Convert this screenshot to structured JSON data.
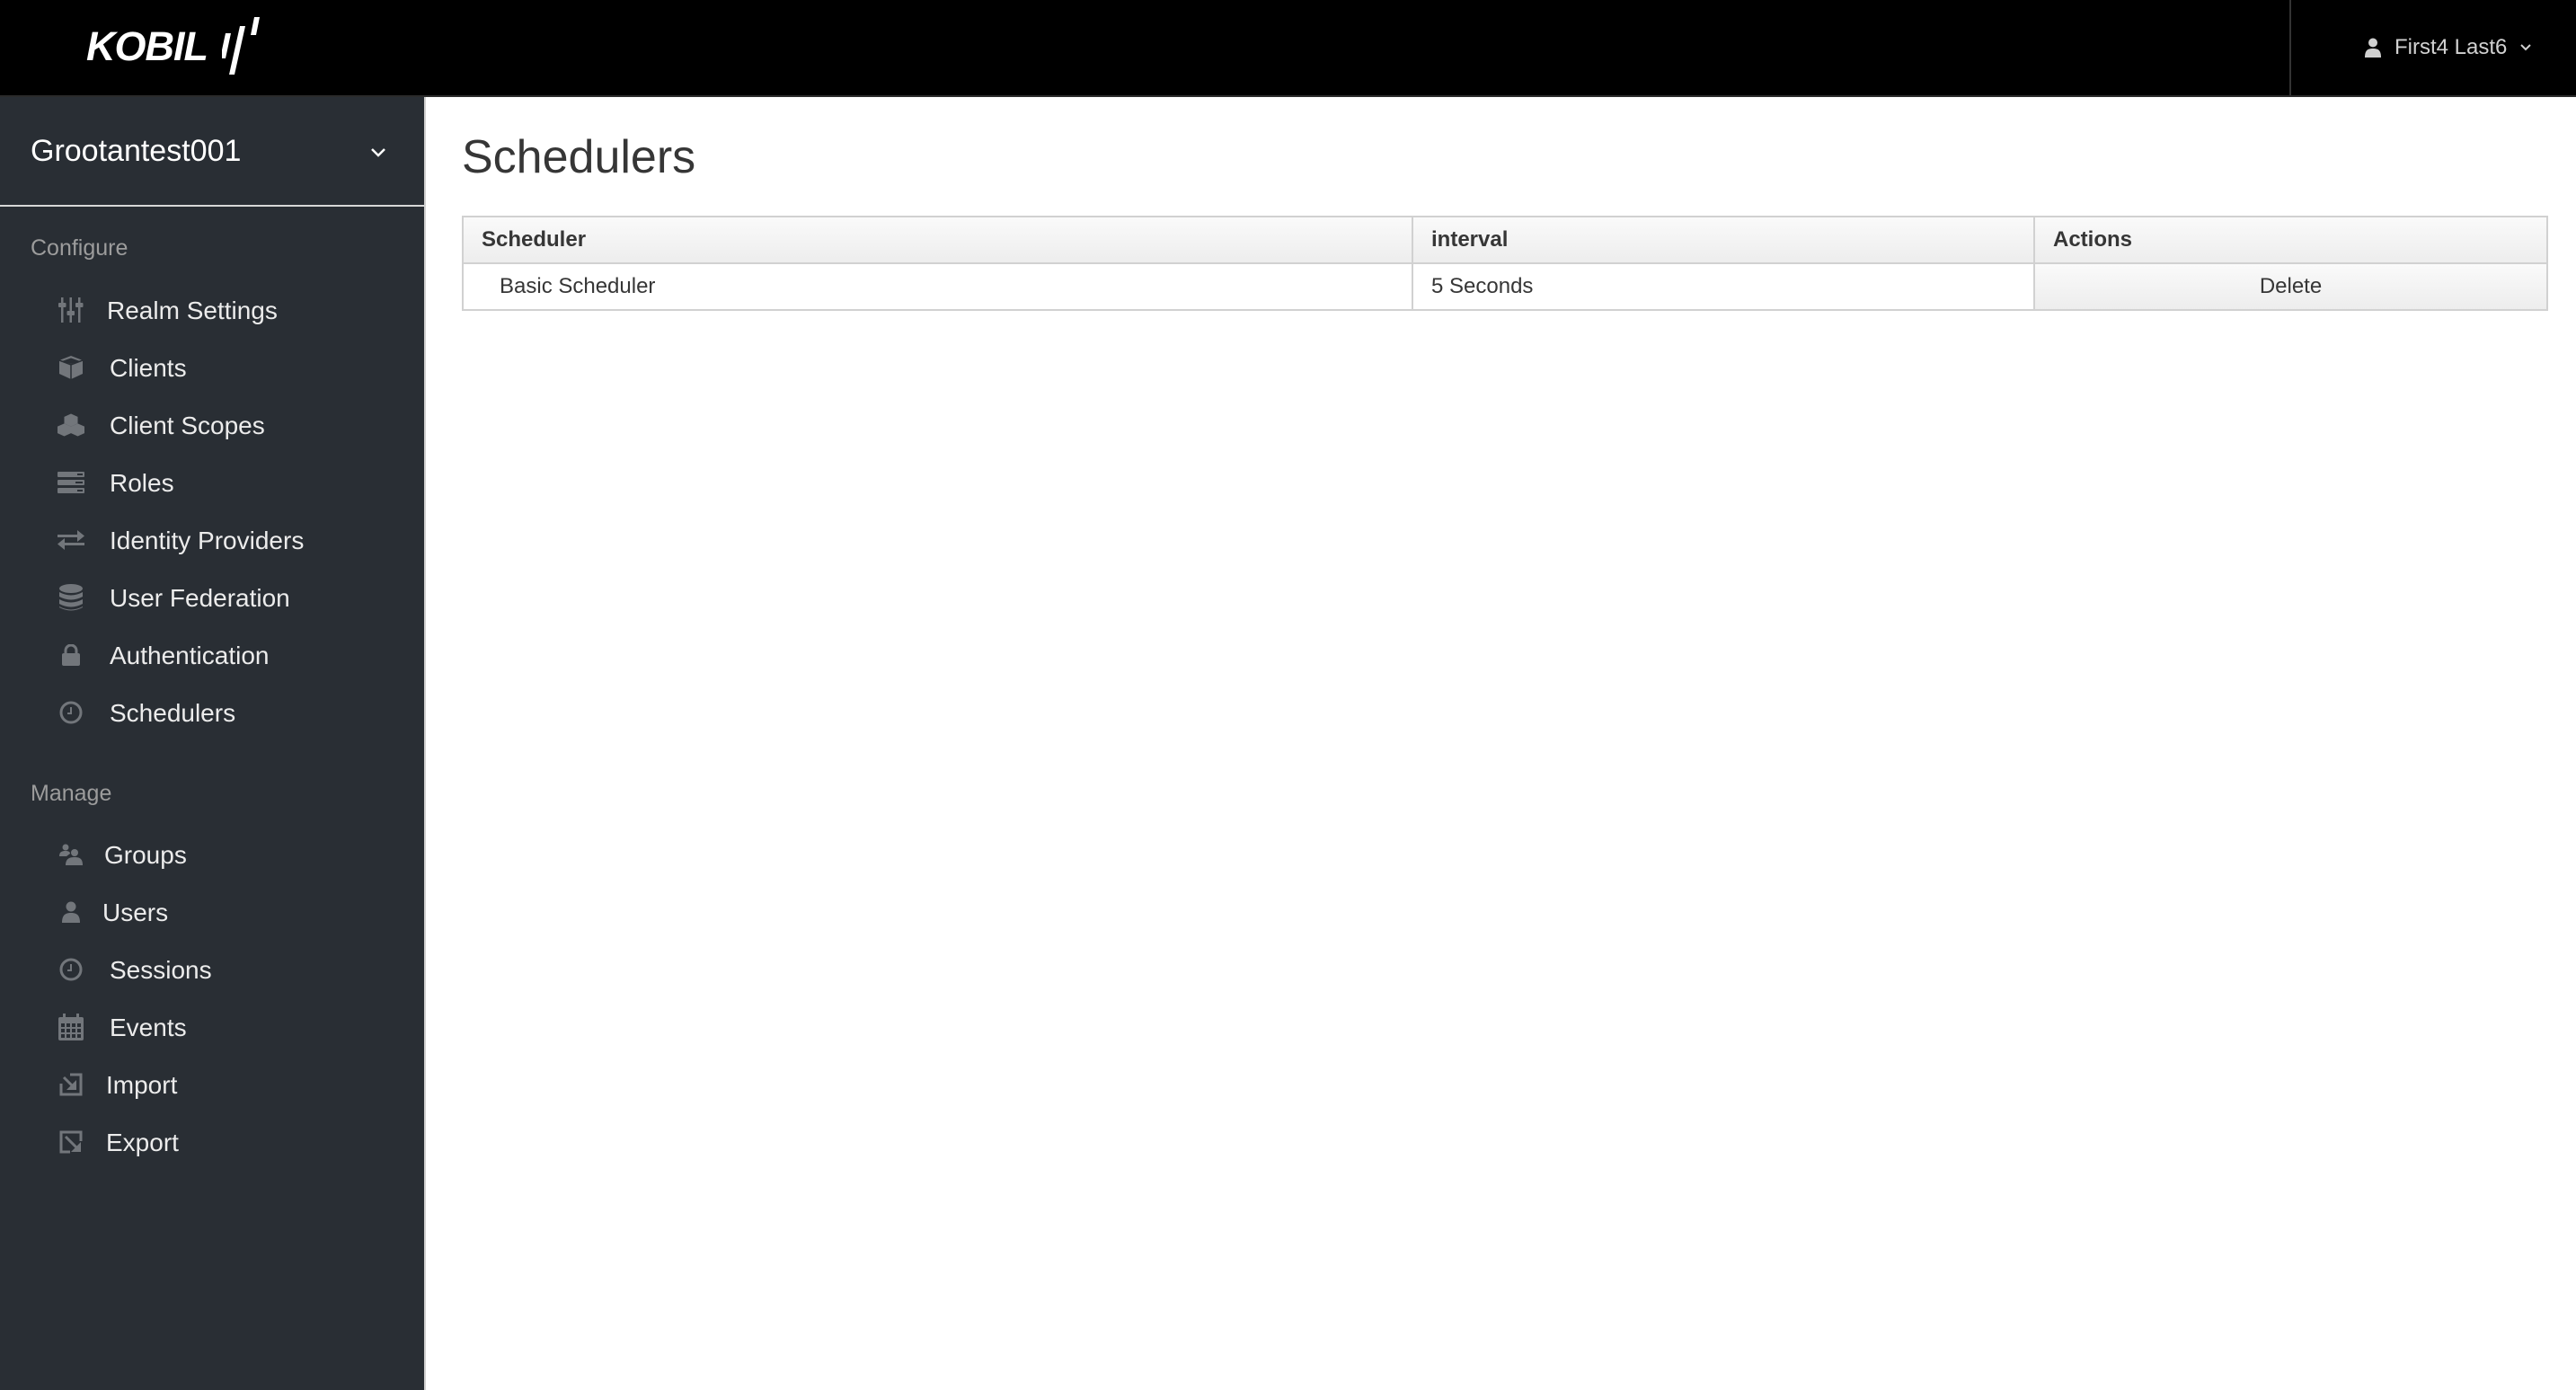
{
  "header": {
    "logo_text": "KOBIL",
    "user_name": "First4 Last6",
    "user_icon": "user-icon",
    "user_menu_icon": "chevron-down-icon"
  },
  "sidebar": {
    "realm": {
      "name": "Grootantest001",
      "icon": "chevron-down-icon"
    },
    "sections": [
      {
        "label": "Configure",
        "items": [
          {
            "label": "Realm Settings",
            "icon": "sliders-icon"
          },
          {
            "label": "Clients",
            "icon": "cube-icon"
          },
          {
            "label": "Client Scopes",
            "icon": "cubes-icon"
          },
          {
            "label": "Roles",
            "icon": "server-icon"
          },
          {
            "label": "Identity Providers",
            "icon": "exchange-icon"
          },
          {
            "label": "User Federation",
            "icon": "database-icon"
          },
          {
            "label": "Authentication",
            "icon": "lock-icon"
          },
          {
            "label": "Schedulers",
            "icon": "clock-icon"
          }
        ]
      },
      {
        "label": "Manage",
        "items": [
          {
            "label": "Groups",
            "icon": "users-icon"
          },
          {
            "label": "Users",
            "icon": "user-icon"
          },
          {
            "label": "Sessions",
            "icon": "clock-icon"
          },
          {
            "label": "Events",
            "icon": "calendar-icon"
          },
          {
            "label": "Import",
            "icon": "import-icon"
          },
          {
            "label": "Export",
            "icon": "export-icon"
          }
        ]
      }
    ]
  },
  "main": {
    "title": "Schedulers",
    "table": {
      "columns": [
        "Scheduler",
        "interval",
        "Actions"
      ],
      "rows": [
        {
          "scheduler": "Basic Scheduler",
          "interval": "5 Seconds",
          "action": "Delete"
        }
      ]
    }
  },
  "colors": {
    "header_bg": "#000000",
    "sidebar_bg": "#292e34",
    "sidebar_icon": "#72767b",
    "title_text": "#363636",
    "table_border": "#d1d1d1"
  }
}
